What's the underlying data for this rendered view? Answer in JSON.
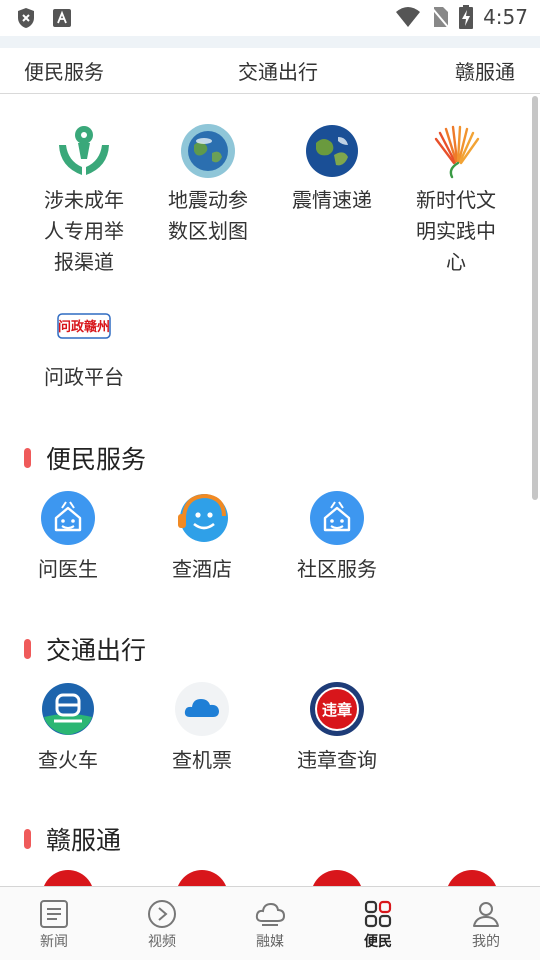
{
  "status_bar": {
    "time": "4:57"
  },
  "subnav": {
    "items": [
      "便民服务",
      "交通出行",
      "赣服通"
    ]
  },
  "top_grid": [
    {
      "label": "涉未成年人专用举报渠道",
      "icon": "child-protection-icon"
    },
    {
      "label": "地震动参数区划图",
      "icon": "globe-icon"
    },
    {
      "label": "震情速递",
      "icon": "earth-icon"
    },
    {
      "label": "新时代文明实践中心",
      "icon": "civilization-logo-icon"
    },
    {
      "label": "问政平台",
      "icon": "wenzheng-logo-icon",
      "logo_text": "问政赣州"
    }
  ],
  "sections": [
    {
      "title": "便民服务",
      "items": [
        {
          "label": "问医生",
          "icon": "house-icon"
        },
        {
          "label": "查酒店",
          "icon": "smiley-headset-icon"
        },
        {
          "label": "社区服务",
          "icon": "house-icon"
        }
      ]
    },
    {
      "title": "交通出行",
      "items": [
        {
          "label": "查火车",
          "icon": "train-icon"
        },
        {
          "label": "查机票",
          "icon": "cloud-icon"
        },
        {
          "label": "违章查询",
          "icon": "violation-icon",
          "badge_text": "违章"
        }
      ]
    },
    {
      "title": "赣服通"
    }
  ],
  "tabbar": {
    "tabs": [
      {
        "label": "新闻",
        "icon": "news-icon"
      },
      {
        "label": "视频",
        "icon": "video-icon"
      },
      {
        "label": "融媒",
        "icon": "cloud-icon"
      },
      {
        "label": "便民",
        "icon": "grid-icon"
      },
      {
        "label": "我的",
        "icon": "user-icon"
      }
    ],
    "active": "便民"
  },
  "colors": {
    "accent_bar": "#ef5a5a",
    "icon_blue": "#3d97f0",
    "brand_red": "#d8161b"
  }
}
